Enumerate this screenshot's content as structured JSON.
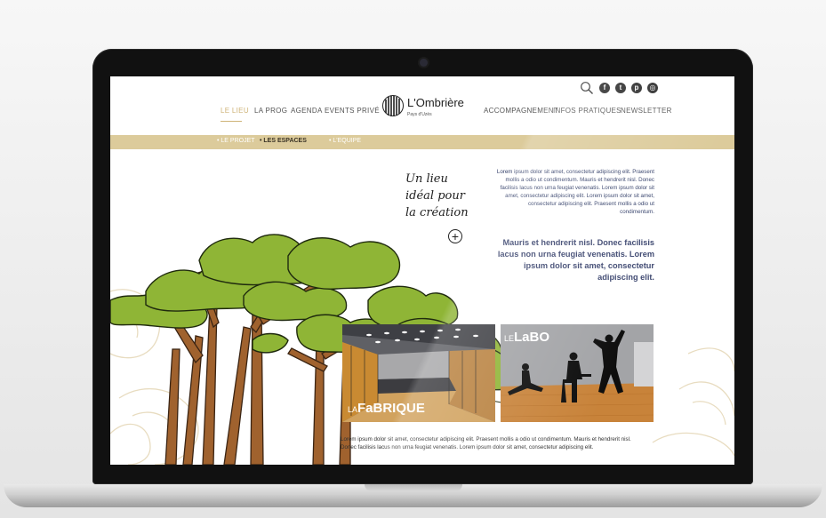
{
  "site": {
    "top_icons": [
      "search-icon",
      "facebook-icon",
      "twitter-icon",
      "pinterest-icon",
      "instagram-icon"
    ],
    "nav_left": [
      "LE LIEU",
      "LA PROG",
      "AGENDA",
      "EVENTS PRIVÉ"
    ],
    "nav_right": [
      "ACCOMPAGNEMENT",
      "INFOS PRATIQUES",
      "NEWSLETTER"
    ],
    "active_nav": "LE LIEU",
    "logo": {
      "name": "L'Ombrière",
      "sub": "Pays d'Uzès"
    },
    "subnav": [
      "• LE PROJET",
      "• LES ESPACES",
      "• L'EQUIPE"
    ],
    "active_subnav": "• LES ESPACES",
    "tagline": [
      "Un lieu",
      "idéal pour",
      "la création"
    ],
    "intro_text": "Lorem ipsum dolor sit amet, consectetur adipiscing elit. Praesent mollis a odio ut condimentum. Mauris et hendrerit nisl. Donec facilisis lacus non urna feugiat venenatis. Lorem ipsum dolor sit amet, consectetur adipiscing elit. Lorem ipsum dolor sit amet, consectetur adipiscing elit. Praesent mollis a odio ut condimentum.",
    "lead_text": "Mauris et hendrerit nisl. Donec facilisis lacus non urna feugiat venenatis. Lorem ipsum dolor sit amet, consectetur adipiscing elit.",
    "tiles": [
      {
        "label_small": "LA",
        "label_big": "FaBRIQUE"
      },
      {
        "label_small": "LE",
        "label_big": "LaBO"
      }
    ],
    "bottom_text": "Lorem ipsum dolor sit amet, consectetur adipiscing elit. Praesent mollis a odio ut condimentum. Mauris et hendrerit nisl. Donec facilisis lacus non urna feugiat venenatis. Lorem ipsum dolor sit amet, consectetur adipiscing elit.",
    "colors": {
      "accent": "#dccb9b",
      "active": "#cfb479",
      "text_blue": "#3d4770",
      "tree_green": "#8fb536",
      "trunk": "#a0622e"
    }
  }
}
